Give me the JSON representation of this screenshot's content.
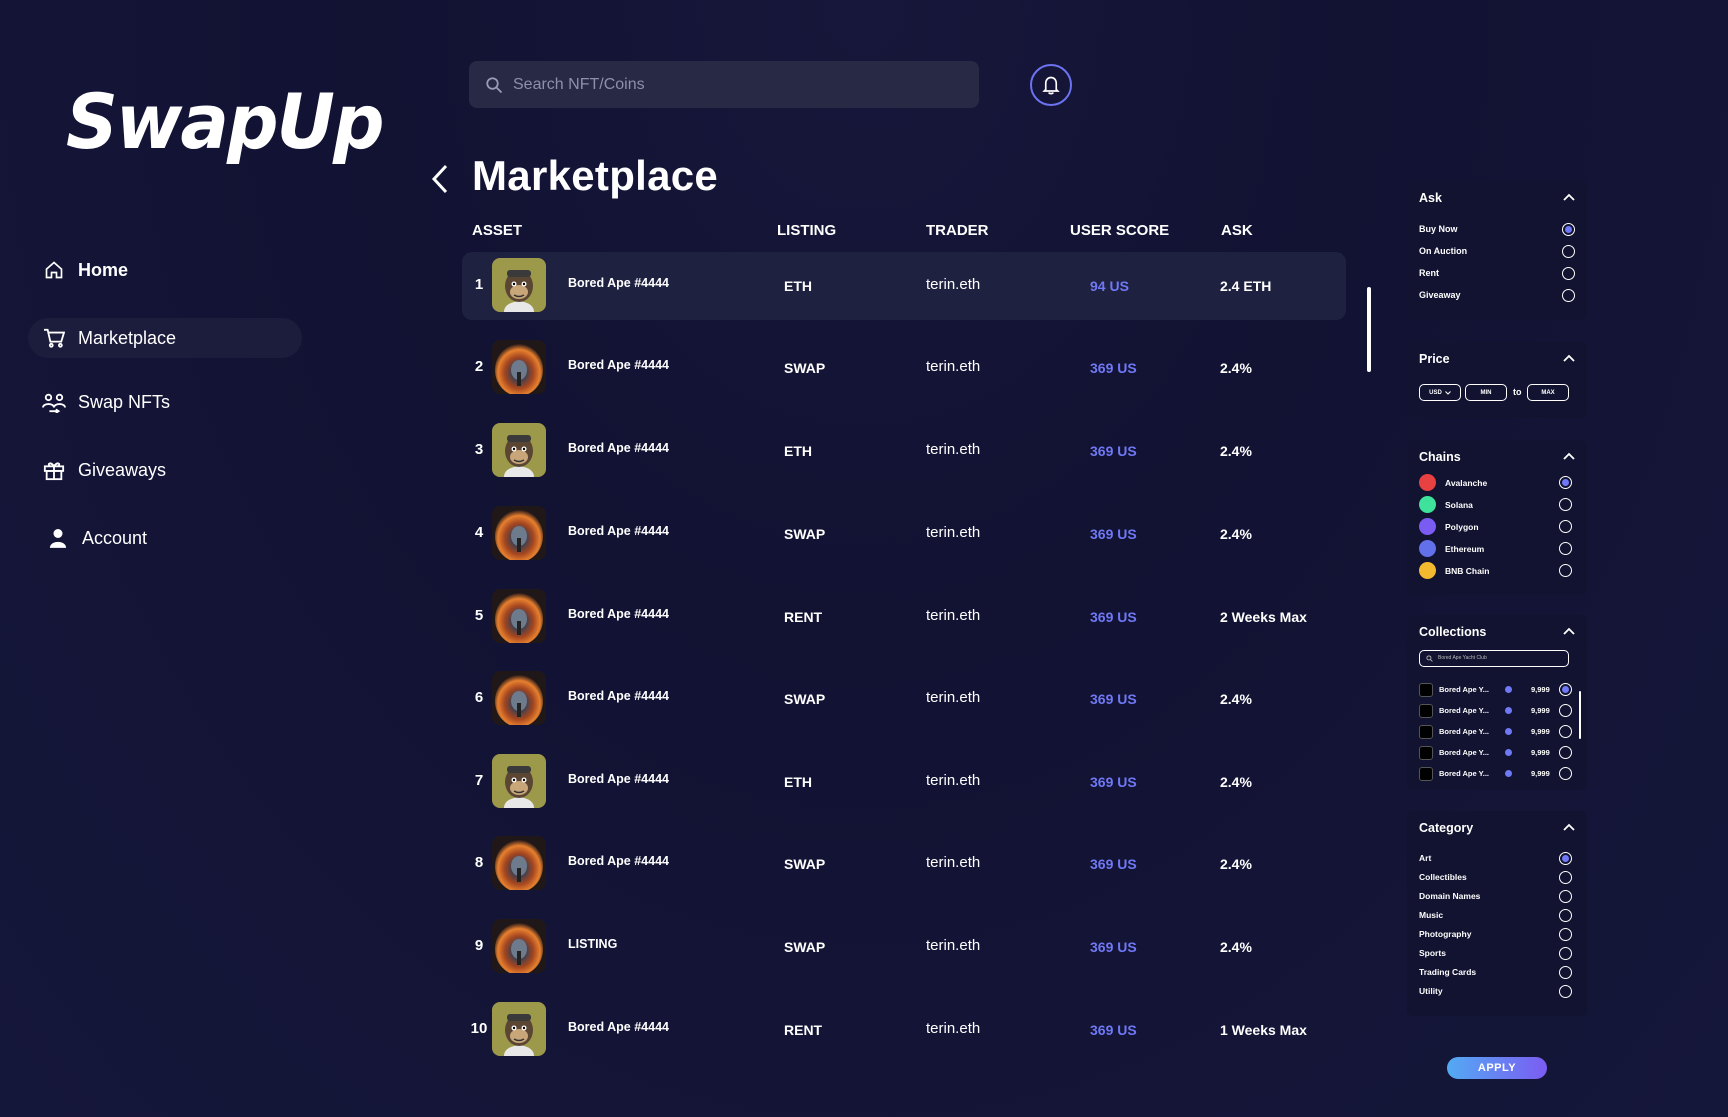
{
  "brand": {
    "logo_text": "SwapUp"
  },
  "nav": {
    "items": [
      {
        "label": "Home",
        "icon": "home-icon"
      },
      {
        "label": "Marketplace",
        "icon": "cart-icon"
      },
      {
        "label": "Swap NFTs",
        "icon": "swap-users-icon"
      },
      {
        "label": "Giveaways",
        "icon": "gift-icon"
      },
      {
        "label": "Account",
        "icon": "user-icon"
      }
    ],
    "active": "Marketplace"
  },
  "search": {
    "placeholder": "Search NFT/Coins",
    "value": ""
  },
  "page": {
    "title": "Marketplace"
  },
  "table": {
    "headers": {
      "asset": "ASSET",
      "listing": "LISTING",
      "trader": "TRADER",
      "user_score": "USER SCORE",
      "ask": "ASK"
    },
    "rows": [
      {
        "rank": "1",
        "asset": "Bored Ape #4444",
        "image": "ape",
        "listing": "ETH",
        "trader": "terin.eth",
        "score": "94 US",
        "ask": "2.4 ETH"
      },
      {
        "rank": "2",
        "asset": "Bored Ape #4444",
        "image": "tunnel",
        "listing": "SWAP",
        "trader": "terin.eth",
        "score": "369 US",
        "ask": "2.4%"
      },
      {
        "rank": "3",
        "asset": "Bored Ape #4444",
        "image": "ape",
        "listing": "ETH",
        "trader": "terin.eth",
        "score": "369 US",
        "ask": "2.4%"
      },
      {
        "rank": "4",
        "asset": "Bored Ape #4444",
        "image": "tunnel",
        "listing": "SWAP",
        "trader": "terin.eth",
        "score": "369 US",
        "ask": "2.4%"
      },
      {
        "rank": "5",
        "asset": "Bored Ape #4444",
        "image": "tunnel",
        "listing": "RENT",
        "trader": "terin.eth",
        "score": "369 US",
        "ask": "2 Weeks Max"
      },
      {
        "rank": "6",
        "asset": "Bored Ape #4444",
        "image": "tunnel",
        "listing": "SWAP",
        "trader": "terin.eth",
        "score": "369 US",
        "ask": "2.4%"
      },
      {
        "rank": "7",
        "asset": "Bored Ape #4444",
        "image": "ape",
        "listing": "ETH",
        "trader": "terin.eth",
        "score": "369 US",
        "ask": "2.4%"
      },
      {
        "rank": "8",
        "asset": "Bored Ape #4444",
        "image": "tunnel",
        "listing": "SWAP",
        "trader": "terin.eth",
        "score": "369 US",
        "ask": "2.4%"
      },
      {
        "rank": "9",
        "asset": "LISTING",
        "image": "tunnel",
        "listing": "SWAP",
        "trader": "terin.eth",
        "score": "369 US",
        "ask": "2.4%"
      },
      {
        "rank": "10",
        "asset": "Bored Ape #4444",
        "image": "ape",
        "listing": "RENT",
        "trader": "terin.eth",
        "score": "369 US",
        "ask": "1 Weeks Max"
      }
    ]
  },
  "filters": {
    "ask": {
      "title": "Ask",
      "options": [
        "Buy Now",
        "On Auction",
        "Rent",
        "Giveaway"
      ],
      "selected": "Buy Now"
    },
    "price": {
      "title": "Price",
      "currency": "USD",
      "min_placeholder": "MIN",
      "to": "to",
      "max_placeholder": "MAX"
    },
    "chains": {
      "title": "Chains",
      "options": [
        {
          "name": "Avalanche",
          "color": "#e84142"
        },
        {
          "name": "Solana",
          "color": "#3ee29a"
        },
        {
          "name": "Polygon",
          "color": "#7b5cf2"
        },
        {
          "name": "Ethereum",
          "color": "#6270ea"
        },
        {
          "name": "BNB Chain",
          "color": "#f3ba2f"
        }
      ],
      "selected": "Avalanche"
    },
    "collections": {
      "title": "Collections",
      "search_placeholder": "Bored Ape Yacht Club",
      "items": [
        {
          "name": "Bored Ape Y...",
          "count": "9,999"
        },
        {
          "name": "Bored Ape Y...",
          "count": "9,999"
        },
        {
          "name": "Bored Ape Y...",
          "count": "9,999"
        },
        {
          "name": "Bored Ape Y...",
          "count": "9,999"
        },
        {
          "name": "Bored Ape Y...",
          "count": "9,999"
        }
      ],
      "selected_index": 0
    },
    "category": {
      "title": "Category",
      "options": [
        "Art",
        "Collectibles",
        "Domain Names",
        "Music",
        "Photography",
        "Sports",
        "Trading Cards",
        "Utility"
      ],
      "selected": "Art"
    },
    "apply_label": "APPLY"
  },
  "colors": {
    "accent": "#6f78f5",
    "background": "#13143a",
    "row_highlight": "#1f2140",
    "panel": "#121330"
  }
}
